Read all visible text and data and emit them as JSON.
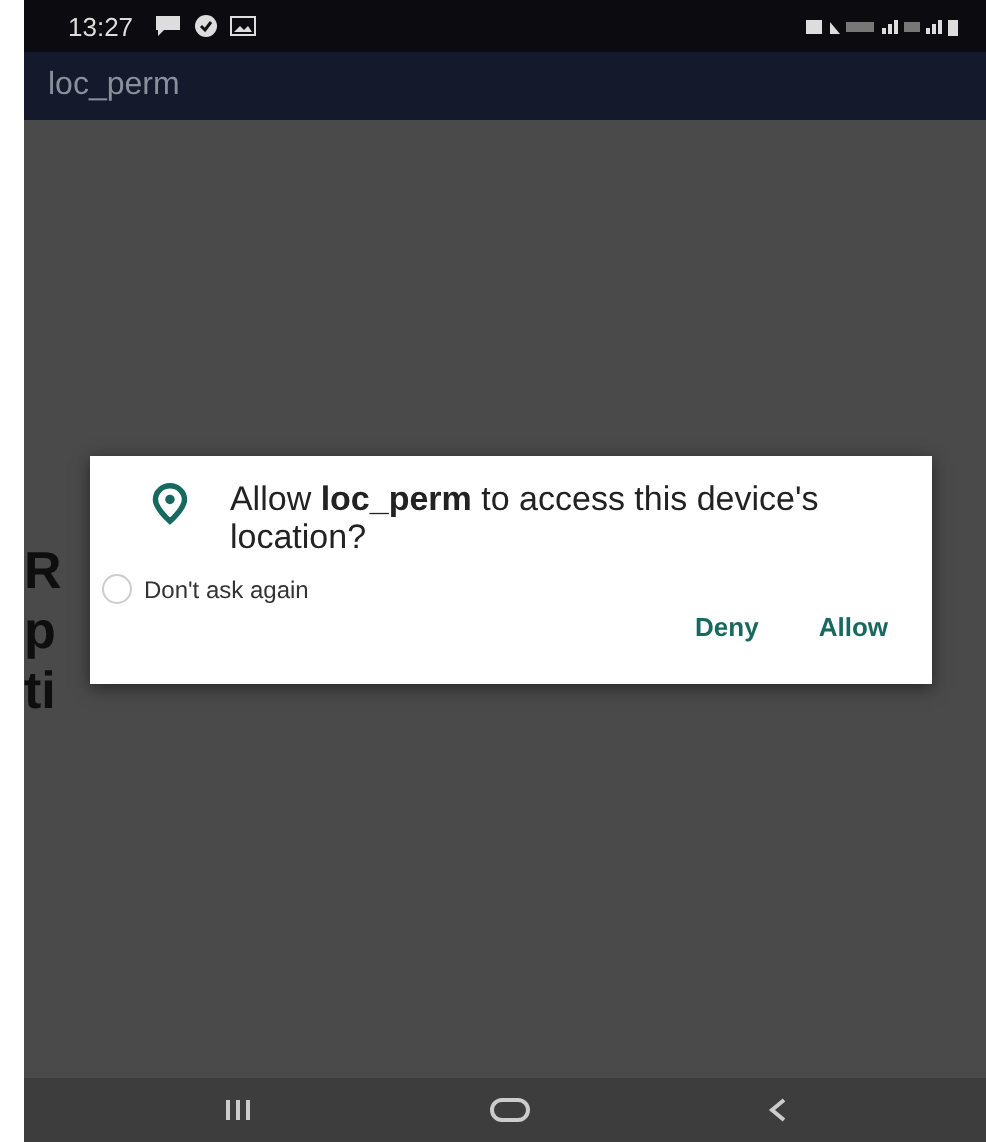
{
  "status_bar": {
    "time": "13:27"
  },
  "app_bar": {
    "title": "loc_perm"
  },
  "background_text": [
    "R",
    "p",
    "ti"
  ],
  "dialog": {
    "message": "Allow **loc_perm** to access this device's location?",
    "dont_ask_again": {
      "label": "Don't ask again",
      "checked": false
    },
    "buttons": [
      "Deny",
      "Allow"
    ]
  }
}
